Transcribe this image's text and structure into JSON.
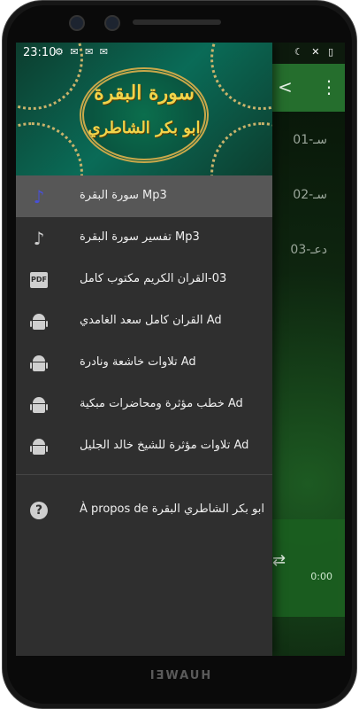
{
  "status": {
    "time": "23:10",
    "left_icons": "⚙ ✉ ✉ ✉",
    "right_icons": "☾ ✕ ▯"
  },
  "header": {
    "title_line1": "سورة البقرة",
    "title_line2": "ابو بكر الشاطري"
  },
  "background_app": {
    "rows": [
      "01-سـ",
      "02-سـ",
      "03-دعـ"
    ],
    "player_time": "0:00"
  },
  "menu": {
    "items": [
      {
        "label": "Mp3 سورة البقرة",
        "icon": "music-note-icon"
      },
      {
        "label": "Mp3 تفسير سورة البقرة",
        "icon": "music-note-icon"
      },
      {
        "label": "03-القران الكريم مكتوب كامل",
        "icon": "pdf-icon",
        "icon_text": "PDF"
      },
      {
        "label": "Ad القران كامل سعد الغامدي",
        "icon": "android-icon"
      },
      {
        "label": "Ad تلاوات خاشعة ونادرة",
        "icon": "android-icon"
      },
      {
        "label": "Ad خطب مؤثرة ومحاضرات مبكية",
        "icon": "android-icon"
      },
      {
        "label": "Ad تلاوات مؤثرة للشيخ خالد الجليل",
        "icon": "android-icon"
      }
    ],
    "about": {
      "label": "À propos de ابو بكر الشاطري البقرة",
      "icon": "help-icon",
      "icon_text": "?"
    }
  },
  "device": {
    "brand": "HUAWEI"
  },
  "colors": {
    "selected_icon": "#4850d8",
    "drawer_bg": "#2f2f2f",
    "selected_bg": "#575757",
    "toolbar": "#256e2d"
  }
}
